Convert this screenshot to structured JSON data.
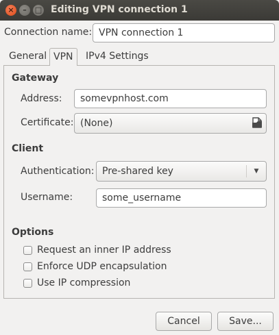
{
  "window": {
    "title": "Editing VPN connection 1",
    "buttons": {
      "close": "×",
      "minimize": "–",
      "maximize": "□"
    }
  },
  "connection_name": {
    "label": "Connection name:",
    "value": "VPN connection 1"
  },
  "tabs": [
    {
      "label": "General",
      "active": false
    },
    {
      "label": "VPN",
      "active": true
    },
    {
      "label": "IPv4 Settings",
      "active": false
    }
  ],
  "gateway": {
    "heading": "Gateway",
    "address_label": "Address:",
    "address_value": "somevpnhost.com",
    "certificate_label": "Certificate:",
    "certificate_value": "(None)",
    "certificate_icon": "open-file-icon"
  },
  "client": {
    "heading": "Client",
    "auth_label": "Authentication:",
    "auth_value": "Pre-shared key",
    "username_label": "Username:",
    "username_value": "some_username"
  },
  "options": {
    "heading": "Options",
    "items": [
      {
        "label": "Request an inner IP address",
        "checked": false
      },
      {
        "label": "Enforce UDP encapsulation",
        "checked": false
      },
      {
        "label": "Use IP compression",
        "checked": false
      }
    ]
  },
  "footer": {
    "cancel_label": "Cancel",
    "save_label": "Save..."
  },
  "colors": {
    "titlebar": "#3b3a36",
    "close_button": "#df4a16",
    "background": "#f2f1f0"
  }
}
